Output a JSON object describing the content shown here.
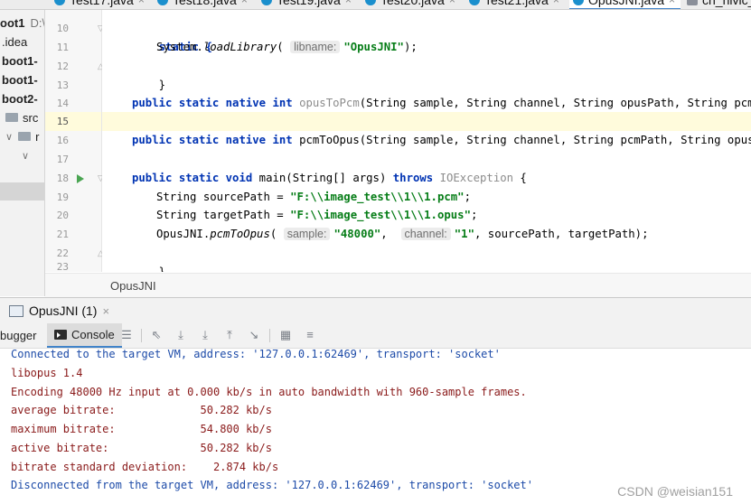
{
  "editor_tabs": [
    {
      "label": "Test17.java"
    },
    {
      "label": "Test18.java"
    },
    {
      "label": "Test19.java"
    },
    {
      "label": "Test20.java"
    },
    {
      "label": "Test21.java"
    },
    {
      "label": "OpusJNI.java",
      "active": true
    },
    {
      "label": "ch_nivic_"
    }
  ],
  "tab_close_glyph": "×",
  "project_tree": {
    "root": "oot1",
    "root_path": "D:\\",
    "items": [
      ".idea",
      "boot1-",
      "boot1-",
      "boot2-",
      "src",
      "r"
    ]
  },
  "code_lines": [
    {
      "num": "10",
      "text": "static {"
    },
    {
      "num": "11",
      "pre": "System.",
      "method": "loadLibrary",
      "open": "(",
      "hint": "libname:",
      "str": "\"OpusJNI\"",
      "close": ");"
    },
    {
      "num": "12",
      "text": "}"
    },
    {
      "num": "13",
      "text": ""
    },
    {
      "num": "14",
      "kw": "public static native int ",
      "name": "opusToPcm",
      "rest": "(String sample, String channel, String opusPath, String pcmPath);"
    },
    {
      "num": "15",
      "text": ""
    },
    {
      "num": "16",
      "kw": "public static native int ",
      "name": "pcmToOpus",
      "rest": "(String sample, String channel, String pcmPath, String opusPath);"
    },
    {
      "num": "17",
      "text": ""
    },
    {
      "num": "18",
      "kw": "public static void ",
      "name": "main",
      "rest": "(String[] args) ",
      "kw2": "throws ",
      "exc": "IOException",
      "end": " {"
    },
    {
      "num": "19",
      "pre": "String sourcePath = ",
      "str": "\"F:\\\\image_test\\\\1\\\\1.pcm\"",
      "end": ";"
    },
    {
      "num": "20",
      "pre": "String targetPath = ",
      "str": "\"F:\\\\image_test\\\\1\\\\1.opus\"",
      "end": ";"
    },
    {
      "num": "21",
      "pre": "OpusJNI.",
      "method": "pcmToOpus",
      "open": "(",
      "hint1": "sample:",
      "str1": "\"48000\"",
      "sep": ", ",
      "hint2": "channel:",
      "str2": "\"1\"",
      "end": ", sourcePath, targetPath);"
    },
    {
      "num": "22",
      "text": "}"
    },
    {
      "num": "23",
      "text": ""
    }
  ],
  "breadcrumb": "OpusJNI",
  "run_window": {
    "tab_label": "OpusJNI (1)",
    "close_glyph": "×",
    "debugger_label": "bugger",
    "console_label": "Console"
  },
  "console_lines": [
    {
      "text": "Connected to the target VM, address: '127.0.0.1:62469', transport: 'socket'",
      "kind": "info"
    },
    {
      "text": "libopus 1.4",
      "kind": "err"
    },
    {
      "text": "Encoding 48000 Hz input at 0.000 kb/s in auto bandwidth with 960-sample frames.",
      "kind": "err"
    },
    {
      "text": "average bitrate:             50.282 kb/s",
      "kind": "err"
    },
    {
      "text": "maximum bitrate:             54.800 kb/s",
      "kind": "err"
    },
    {
      "text": "active bitrate:              50.282 kb/s",
      "kind": "err"
    },
    {
      "text": "bitrate standard deviation:    2.874 kb/s",
      "kind": "err"
    },
    {
      "text": "Disconnected from the target VM, address: '127.0.0.1:62469', transport: 'socket'",
      "kind": "info"
    }
  ],
  "watermark": "CSDN @weisian151",
  "colors": {
    "keyword": "#0033b3",
    "string": "#067d17",
    "console_info": "#1d4ba8",
    "console_err": "#8a1a1a",
    "current_line": "#fffbdc",
    "run_icon": "#4aa552",
    "tab_accent": "#4083c9"
  }
}
